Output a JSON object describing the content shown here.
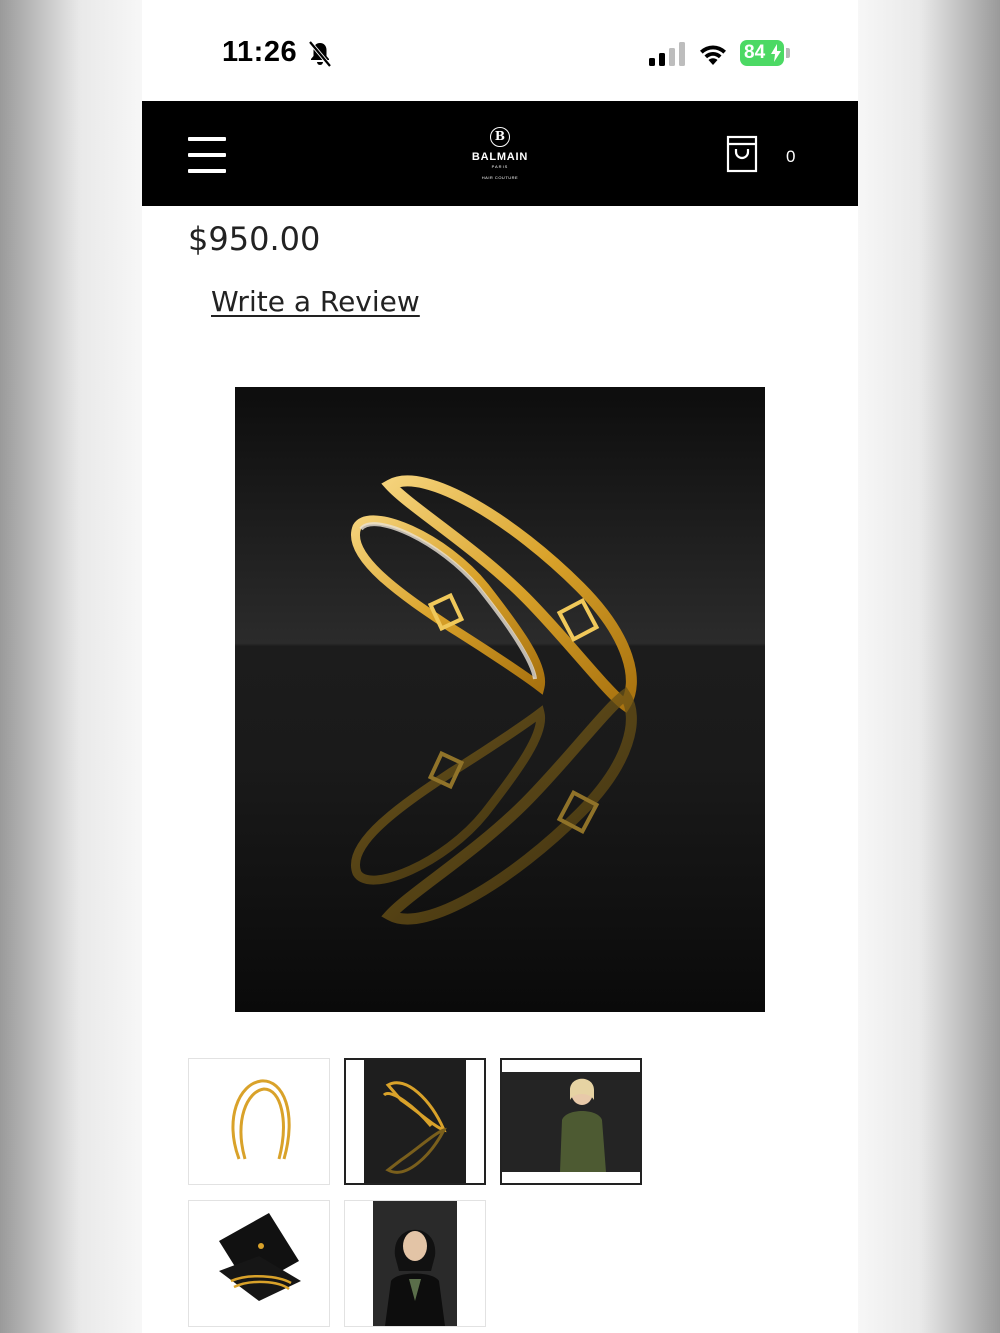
{
  "status_bar": {
    "time": "11:26",
    "battery": "84",
    "icons": [
      "bell-slash-icon",
      "cellular-signal-icon",
      "wifi-icon",
      "battery-charging-icon"
    ]
  },
  "header": {
    "menu_icon": "hamburger-menu-icon",
    "logo_name": "BALMAIN",
    "logo_sub": "PARIS",
    "logo_tagline": "HAIR COUTURE",
    "cart_icon": "shopping-bag-icon",
    "cart_count": "0"
  },
  "product": {
    "price": "$950.00",
    "review_link": "Write a Review"
  },
  "colors": {
    "header_bg": "#000000",
    "gold": "#d7a52c",
    "battery_green": "#4cd964"
  },
  "gallery": {
    "selected_index": 1,
    "thumbnails": [
      "headband-white-background",
      "headband-black-background-reflection",
      "model-blonde-green-dress",
      "headband-gift-box",
      "model-dark-hair-black-jacket"
    ]
  }
}
